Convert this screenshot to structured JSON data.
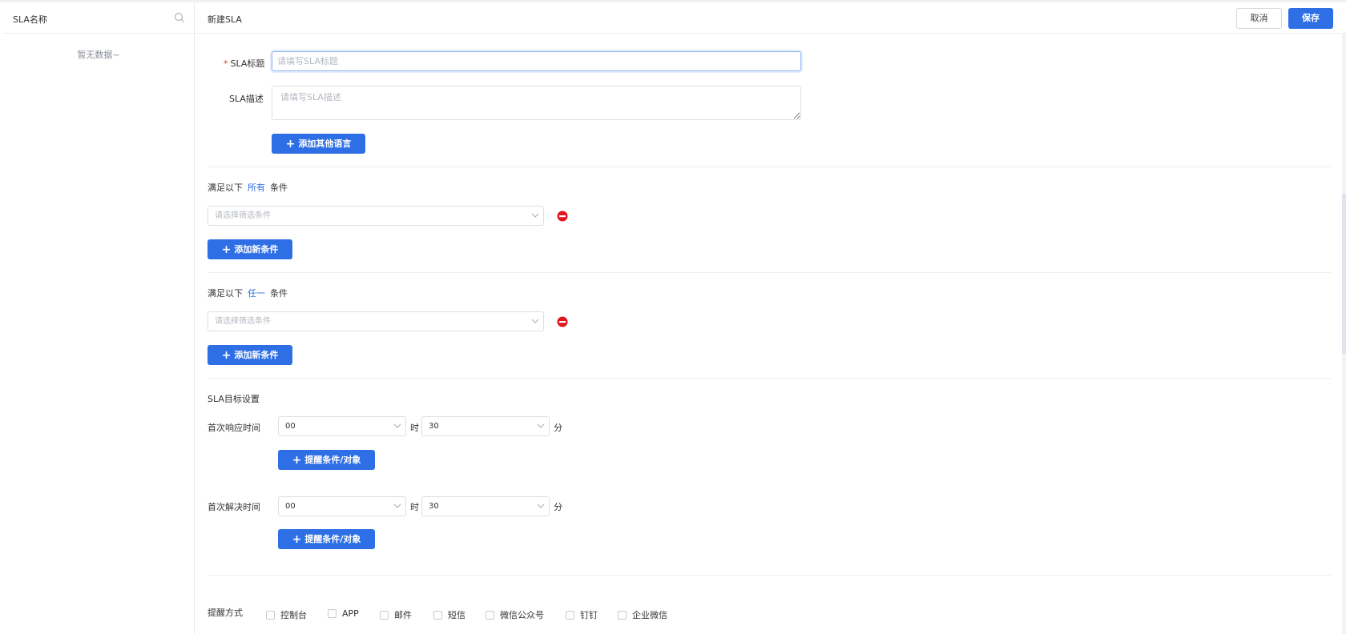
{
  "sidebar": {
    "search_placeholder": "SLA名称",
    "empty_text": "暂无数据~"
  },
  "header": {
    "title": "新建SLA",
    "cancel_label": "取消",
    "save_label": "保存"
  },
  "form": {
    "title_label": "SLA标题",
    "title_required_mark": "*",
    "title_placeholder": "请填写SLA标题",
    "title_value": "",
    "desc_label": "SLA描述",
    "desc_placeholder": "请填写SLA描述",
    "desc_value": "",
    "add_language_label": "添加其他语言"
  },
  "condition_groups": [
    {
      "prefix": "满足以下",
      "mode": "所有",
      "suffix": "条件",
      "select_placeholder": "请选择筛选条件",
      "add_label": "添加新条件"
    },
    {
      "prefix": "满足以下",
      "mode": "任一",
      "suffix": "条件",
      "select_placeholder": "请选择筛选条件",
      "add_label": "添加新条件"
    }
  ],
  "targets": {
    "section_title": "SLA目标设置",
    "hour_unit": "时",
    "minute_unit": "分",
    "rows": [
      {
        "label": "首次响应时间",
        "hours": "00",
        "minutes": "30",
        "remind_label": "提醒条件/对象"
      },
      {
        "label": "首次解决时间",
        "hours": "00",
        "minutes": "30",
        "remind_label": "提醒条件/对象"
      }
    ]
  },
  "reminder": {
    "label": "提醒方式",
    "options": [
      {
        "label": "控制台",
        "checked": false
      },
      {
        "label": "APP",
        "checked": false
      },
      {
        "label": "邮件",
        "checked": false
      },
      {
        "label": "短信",
        "checked": false
      },
      {
        "label": "微信公众号",
        "checked": false
      },
      {
        "label": "钉钉",
        "checked": false
      },
      {
        "label": "企业微信",
        "checked": false
      }
    ]
  },
  "colors": {
    "primary": "#2e6fe6",
    "danger": "#e0161d",
    "required": "#e53935"
  },
  "icons": {
    "search": "search-icon",
    "plus": "plus-icon",
    "chevron": "chevron-down-icon",
    "remove": "remove-condition-icon"
  }
}
